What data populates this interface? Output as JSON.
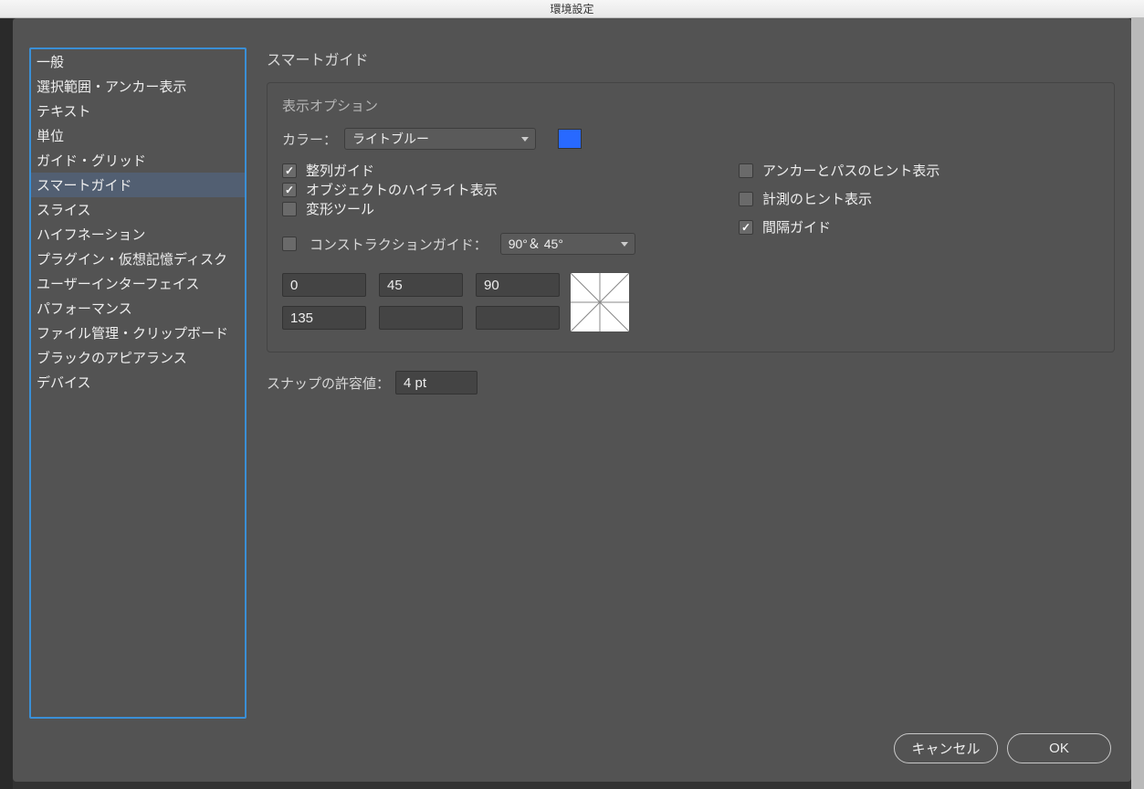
{
  "window": {
    "title": "環境設定"
  },
  "sidebar": {
    "items": [
      {
        "label": "一般"
      },
      {
        "label": "選択範囲・アンカー表示"
      },
      {
        "label": "テキスト"
      },
      {
        "label": "単位"
      },
      {
        "label": "ガイド・グリッド"
      },
      {
        "label": "スマートガイド"
      },
      {
        "label": "スライス"
      },
      {
        "label": "ハイフネーション"
      },
      {
        "label": "プラグイン・仮想記憶ディスク"
      },
      {
        "label": "ユーザーインターフェイス"
      },
      {
        "label": "パフォーマンス"
      },
      {
        "label": "ファイル管理・クリップボード"
      },
      {
        "label": "ブラックのアピアランス"
      },
      {
        "label": "デバイス"
      }
    ],
    "selected_index": 5
  },
  "panel": {
    "title": "スマートガイド",
    "group_title": "表示オプション",
    "color_label": "カラー：",
    "color_value": "ライトブルー",
    "color_swatch": "#2869ff",
    "checks_left": [
      {
        "label": "整列ガイド",
        "checked": true
      },
      {
        "label": "オブジェクトのハイライト表示",
        "checked": true
      },
      {
        "label": "変形ツール",
        "checked": false
      }
    ],
    "checks_right": [
      {
        "label": "アンカーとパスのヒント表示",
        "checked": false
      },
      {
        "label": "計測のヒント表示",
        "checked": false
      },
      {
        "label": "間隔ガイド",
        "checked": true
      }
    ],
    "construction": {
      "label": "コンストラクションガイド：",
      "checked": false,
      "select_value": "90°＆ 45°",
      "angles": [
        "0",
        "45",
        "90",
        "135",
        "",
        ""
      ]
    },
    "snap": {
      "label": "スナップの許容値：",
      "value": "4 pt"
    }
  },
  "footer": {
    "cancel": "キャンセル",
    "ok": "OK"
  }
}
